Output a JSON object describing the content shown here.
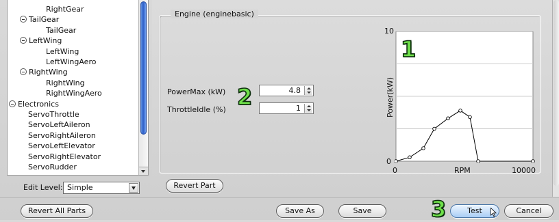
{
  "tree": {
    "items": [
      {
        "label": "RightGear",
        "indent": 3,
        "toggle": false
      },
      {
        "label": "TailGear",
        "indent": 2,
        "toggle": true
      },
      {
        "label": "TailGear",
        "indent": 3,
        "toggle": false
      },
      {
        "label": "LeftWing",
        "indent": 2,
        "toggle": true
      },
      {
        "label": "LeftWing",
        "indent": 3,
        "toggle": false
      },
      {
        "label": "LeftWingAero",
        "indent": 3,
        "toggle": false
      },
      {
        "label": "RightWing",
        "indent": 2,
        "toggle": true
      },
      {
        "label": "RightWing",
        "indent": 3,
        "toggle": false
      },
      {
        "label": "RightWingAero",
        "indent": 3,
        "toggle": false
      },
      {
        "label": "Electronics",
        "indent": 1,
        "toggle": true
      },
      {
        "label": "ServoThrottle",
        "indent": 2,
        "toggle": false
      },
      {
        "label": "ServoLeftAileron",
        "indent": 2,
        "toggle": false
      },
      {
        "label": "ServoRightAileron",
        "indent": 2,
        "toggle": false
      },
      {
        "label": "ServoLeftElevator",
        "indent": 2,
        "toggle": false
      },
      {
        "label": "ServoRightElevator",
        "indent": 2,
        "toggle": false
      },
      {
        "label": "ServoRudder",
        "indent": 2,
        "toggle": false
      }
    ]
  },
  "edit_level": {
    "label": "Edit Level:",
    "value": "Simple"
  },
  "engine": {
    "group_title": "Engine (enginebasic)",
    "power_max": {
      "label": "PowerMax (kW)",
      "value": "4.8"
    },
    "throttle_idle": {
      "label": "ThrottleIdle (%)",
      "value": "1"
    }
  },
  "annotations": {
    "one": "1",
    "two": "2",
    "three": "3"
  },
  "buttons": {
    "revert_part": "Revert Part",
    "revert_all": "Revert All Parts",
    "save_as": "Save As",
    "save": "Save",
    "test": "Test",
    "cancel": "Cancel"
  },
  "chart_data": {
    "type": "line",
    "title": "",
    "xlabel": "RPM",
    "ylabel": "Power(kW)",
    "xlim": [
      0,
      10000
    ],
    "ylim": [
      0,
      10
    ],
    "x_ticks": [
      "0",
      "10000"
    ],
    "y_ticks": [
      "0",
      "10"
    ],
    "grid": true,
    "x": [
      0,
      1000,
      2000,
      2800,
      3800,
      4700,
      5400,
      6000,
      10000
    ],
    "y": [
      0,
      0.3,
      1.0,
      2.5,
      3.3,
      3.9,
      3.4,
      0,
      0
    ],
    "colors": {
      "line": "#000000",
      "marker_fill": "#ffffff",
      "plot_bg": "#ffffff",
      "grid": "#cccccc"
    }
  },
  "colors": {
    "annotation": "#6fe04a",
    "scroll_thumb": "#2e5fc8",
    "primary_button": "#a9cdf5"
  }
}
